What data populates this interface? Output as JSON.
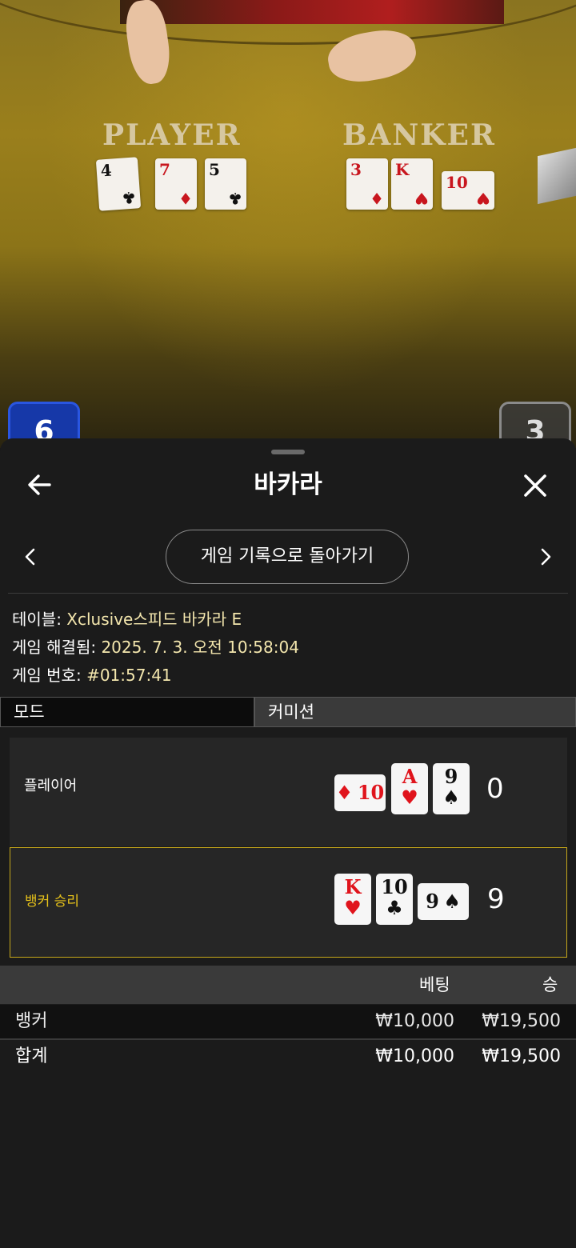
{
  "table_view": {
    "player_label": "PLAYER",
    "banker_label": "BANKER",
    "player_cards": [
      {
        "rank": "4",
        "suit": "♣",
        "color": "black"
      },
      {
        "rank": "7",
        "suit": "♦",
        "color": "red"
      },
      {
        "rank": "5",
        "suit": "♣",
        "color": "black"
      }
    ],
    "banker_cards": [
      {
        "rank": "3",
        "suit": "♦",
        "color": "red"
      },
      {
        "rank": "K",
        "suit": "♥",
        "color": "red"
      },
      {
        "rank": "10",
        "suit": "♥",
        "color": "red"
      }
    ],
    "player_score": "6",
    "banker_score": "3"
  },
  "sheet": {
    "title": "바카라",
    "history_button": "게임 기록으로 돌아가기",
    "info": {
      "table_label": "테이블: ",
      "table_value": "Xclusive스피드 바카라 E",
      "resolved_label": "게임 해결됨: ",
      "resolved_value": "2025. 7. 3. 오전 10:58:04",
      "number_label": "게임 번호: ",
      "number_value": "#01:57:41"
    },
    "mode_label": "모드",
    "mode_value": "커미션",
    "player_result": {
      "label": "플레이어",
      "total": "0",
      "cards": [
        {
          "rank": "10",
          "suit": "♦",
          "color": "red",
          "orientation": "horizontal"
        },
        {
          "rank": "A",
          "suit": "♥",
          "color": "red",
          "orientation": "vertical"
        },
        {
          "rank": "9",
          "suit": "♠",
          "color": "black",
          "orientation": "vertical"
        }
      ]
    },
    "banker_result": {
      "label": "뱅커 승리",
      "total": "9",
      "cards": [
        {
          "rank": "K",
          "suit": "♥",
          "color": "red",
          "orientation": "vertical"
        },
        {
          "rank": "10",
          "suit": "♣",
          "color": "black",
          "orientation": "vertical"
        },
        {
          "rank": "9",
          "suit": "♠",
          "color": "black",
          "orientation": "horizontal"
        }
      ]
    },
    "bet_table": {
      "headers": {
        "bet": "베팅",
        "win": "승"
      },
      "rows": [
        {
          "name": "뱅커",
          "bet": "₩10,000",
          "win": "₩19,500"
        }
      ],
      "total": {
        "name": "합계",
        "bet": "₩10,000",
        "win": "₩19,500"
      }
    }
  },
  "colors": {
    "accent_gold": "#e6c21a",
    "info_value": "#f3e6ad",
    "player_blue": "#1638a8",
    "sheet_bg": "#1b1b1b"
  },
  "icons": {
    "back": "arrow-left-icon",
    "close": "close-icon",
    "prev": "chevron-left-icon",
    "next": "chevron-right-icon"
  }
}
